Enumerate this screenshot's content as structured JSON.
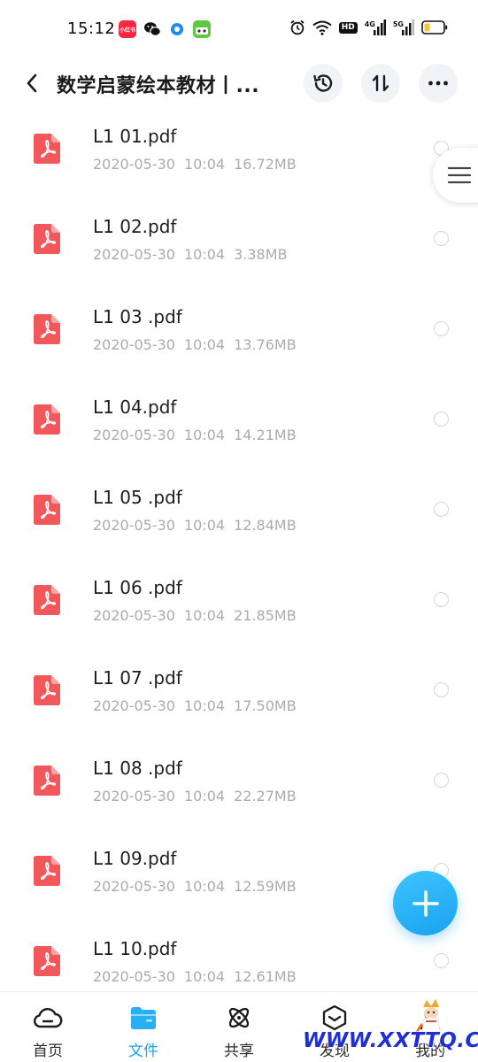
{
  "status_bar": {
    "time": "15:12",
    "app_icons": [
      "news-app-icon",
      "wechat-icon",
      "qq-browser-icon",
      "game-app-icon"
    ],
    "indicators": [
      "alarm-icon",
      "wifi-icon",
      "hd-icon",
      "signal-4g-icon",
      "signal-5g-icon",
      "battery-icon"
    ],
    "hd_label": "HD",
    "net1": "4G",
    "net2": "5G",
    "app_badge_text": "小红书"
  },
  "header": {
    "title": "数学启蒙绘本教材丨...",
    "actions": [
      "history-icon",
      "sort-icon",
      "more-icon"
    ]
  },
  "files": [
    {
      "name": "L1 01.pdf",
      "date": "2020-05-30",
      "time": "10:04",
      "size": "16.72MB"
    },
    {
      "name": "L1 02.pdf",
      "date": "2020-05-30",
      "time": "10:04",
      "size": "3.38MB"
    },
    {
      "name": "L1 03 .pdf",
      "date": "2020-05-30",
      "time": "10:04",
      "size": "13.76MB"
    },
    {
      "name": "L1 04.pdf",
      "date": "2020-05-30",
      "time": "10:04",
      "size": "14.21MB"
    },
    {
      "name": "L1 05 .pdf",
      "date": "2020-05-30",
      "time": "10:04",
      "size": "12.84MB"
    },
    {
      "name": "L1 06 .pdf",
      "date": "2020-05-30",
      "time": "10:04",
      "size": "21.85MB"
    },
    {
      "name": "L1 07 .pdf",
      "date": "2020-05-30",
      "time": "10:04",
      "size": "17.50MB"
    },
    {
      "name": "L1 08 .pdf",
      "date": "2020-05-30",
      "time": "10:04",
      "size": "22.27MB"
    },
    {
      "name": "L1 09.pdf",
      "date": "2020-05-30",
      "time": "10:04",
      "size": "12.59MB"
    },
    {
      "name": "L1 10.pdf",
      "date": "2020-05-30",
      "time": "10:04",
      "size": "12.61MB"
    }
  ],
  "nav": {
    "items": [
      {
        "label": "首页",
        "icon": "cloud-icon",
        "active": false
      },
      {
        "label": "文件",
        "icon": "folder-icon",
        "active": true
      },
      {
        "label": "共享",
        "icon": "atom-icon",
        "active": false
      },
      {
        "label": "发现",
        "icon": "discover-box-icon",
        "active": false
      },
      {
        "label": "我的",
        "icon": "profile-icon",
        "active": false
      }
    ]
  },
  "watermark": {
    "text": "WWW.XXTTQ.COM"
  },
  "colors": {
    "accent": "#1aa2ef",
    "pdf_red": "#f2575c",
    "meta_gray": "#a9abaf",
    "watermark_blue": "#1f2fd6"
  }
}
